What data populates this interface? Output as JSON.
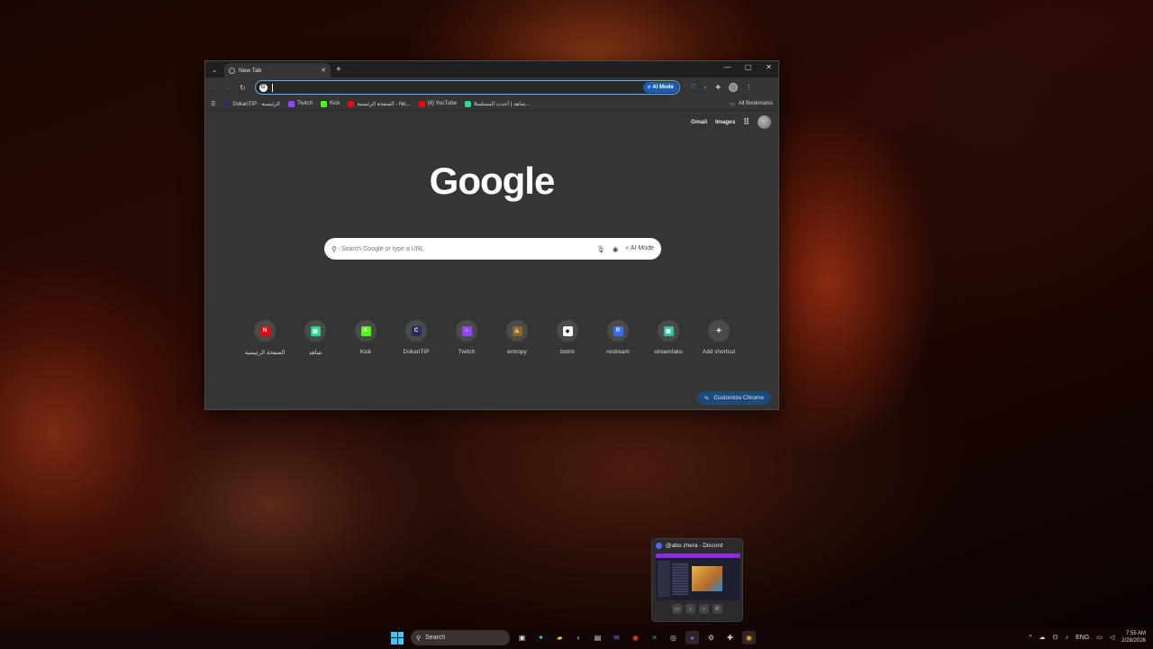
{
  "browser": {
    "tab_title": "New Tab",
    "omnibox_ai_label": "AI Mode",
    "bookmarks": [
      {
        "label": "DokanTIP - الرئيسية",
        "color": "#2d2d5a"
      },
      {
        "label": "Twitch",
        "color": "#9146ff"
      },
      {
        "label": "Kick",
        "color": "#53fc18"
      },
      {
        "label": "الصفحة الرئيسية - Ne...",
        "color": "#e50914"
      },
      {
        "label": "(8) YouTube",
        "color": "#ff0000"
      },
      {
        "label": "شاهد | أحدث المسلسلا...",
        "color": "#32d68c"
      }
    ],
    "all_bookmarks_label": "All Bookmarks"
  },
  "ntp": {
    "gmail_label": "Gmail",
    "images_label": "Images",
    "logo_text": "Google",
    "search_placeholder": "Search Google or type a URL",
    "search_ai_label": "AI Mode",
    "shortcuts": [
      {
        "label": "الصفحة الرئيسية",
        "icon": "netflix-icon",
        "color": "#e50914",
        "glyph": "N"
      },
      {
        "label": "شاهد",
        "icon": "shahid-icon",
        "color": "#32d68c",
        "glyph": "▦"
      },
      {
        "label": "Kick",
        "icon": "kick-icon",
        "color": "#53fc18",
        "glyph": "K"
      },
      {
        "label": "DokanTIP",
        "icon": "dokantip-icon",
        "color": "#2d2d5a",
        "glyph": "C"
      },
      {
        "label": "Twitch",
        "icon": "twitch-icon",
        "color": "#9146ff",
        "glyph": "⌂"
      },
      {
        "label": "entropy",
        "icon": "entropy-icon",
        "color": "#8a6a2a",
        "glyph": "♨"
      },
      {
        "label": "botrix",
        "icon": "botrix-icon",
        "color": "#ffffff",
        "glyph": "◆"
      },
      {
        "label": "restream",
        "icon": "restream-icon",
        "color": "#3b6cf5",
        "glyph": "R"
      },
      {
        "label": "streamlabs",
        "icon": "streamlabs-icon",
        "color": "#31c3a2",
        "glyph": "▣"
      },
      {
        "label": "Add shortcut",
        "icon": "plus-icon",
        "color": "#4a4a4a",
        "glyph": "+"
      }
    ],
    "customize_label": "Customize Chrome"
  },
  "preview": {
    "title": "@abo zhera - Discord"
  },
  "taskbar": {
    "search_label": "Search",
    "language": "ENG",
    "time": "7:55 AM",
    "date": "2/28/2026"
  }
}
